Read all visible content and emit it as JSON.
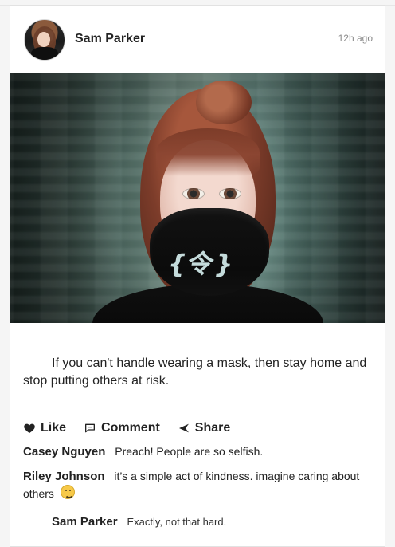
{
  "post": {
    "author": "Sam Parker",
    "time": "12h ago",
    "caption": "If you can't handle wearing a mask, then stay home and stop putting others at risk.",
    "actions": {
      "like": "Like",
      "comment": "Comment",
      "share": "Share"
    }
  },
  "comments": [
    {
      "name": "Casey Nguyen",
      "text": "Preach! People are so selfish."
    },
    {
      "name": "Riley Johnson",
      "text": "it’s a simple act of kindness. imagine caring about others"
    }
  ],
  "reply": {
    "name": "Sam Parker",
    "text": "Exactly, not that hard."
  },
  "icons": {
    "like": "heart-icon",
    "comment": "comment-icon",
    "share": "share-icon",
    "emoji": "disappointed-emoji-icon"
  },
  "colors": {
    "text": "#222222",
    "muted": "#8a8a8a",
    "border": "#e2e2e2",
    "background": "#f5f5f5"
  }
}
